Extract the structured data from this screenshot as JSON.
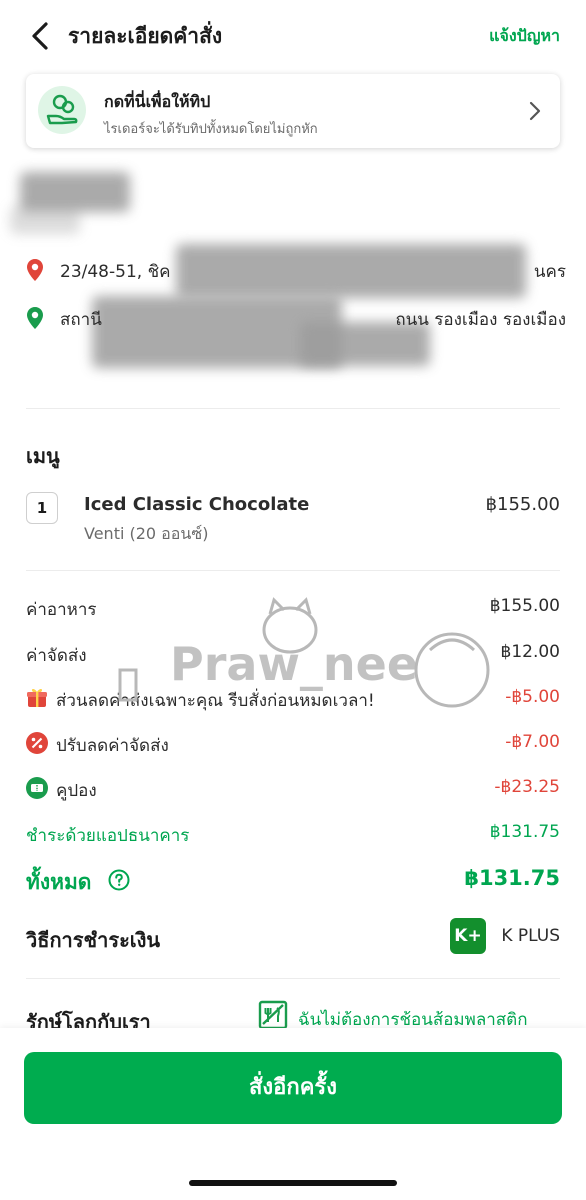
{
  "header": {
    "title": "รายละเอียดคำสั่ง",
    "report_link": "แจ้งปัญหา"
  },
  "tip_card": {
    "title": "กดที่นี่เพื่อให้ทิป",
    "subtitle": "ไรเดอร์จะได้รับทิปทั้งหมดโดยไม่ถูกหัก"
  },
  "addresses": {
    "pickup": "23/48-51, ชิค",
    "pickup_tail": "นคร",
    "dropoff": "สถานี",
    "dropoff_tail": "ถนน รองเมือง รองเมือง"
  },
  "menu": {
    "title": "เมนู",
    "items": [
      {
        "qty": "1",
        "name": "Iced Classic Chocolate",
        "option": "Venti (20 ออนซ์)",
        "price": "฿155.00"
      }
    ]
  },
  "summary": {
    "food_label": "ค่าอาหาร",
    "food_value": "฿155.00",
    "delivery_label": "ค่าจัดส่ง",
    "delivery_value": "฿12.00",
    "promo_label": "ส่วนลดค่าส่งเฉพาะคุณ รีบสั่งก่อนหมดเวลา!",
    "promo_value": "-฿5.00",
    "adjust_label": "ปรับลดค่าจัดส่ง",
    "adjust_value": "-฿7.00",
    "coupon_label": "คูปอง",
    "coupon_value": "-฿23.25",
    "bank_label": "ชำระด้วยแอปธนาคาร",
    "bank_value": "฿131.75",
    "total_label": "ทั้งหมด",
    "total_value": "฿131.75"
  },
  "payment": {
    "title": "วิธีการชำระเงิน",
    "logo_text": "K+",
    "method": "K PLUS"
  },
  "eco": {
    "title": "รักษ์โลกกับเรา",
    "option": "ฉันไม่ต้องการช้อนส้อมพลาสติก"
  },
  "reorder_button": "สั่งอีกครั้ง",
  "watermark": "Praw_nee",
  "colors": {
    "accent": "#00a650",
    "button": "#00ac4f",
    "negative": "#e0453a"
  }
}
